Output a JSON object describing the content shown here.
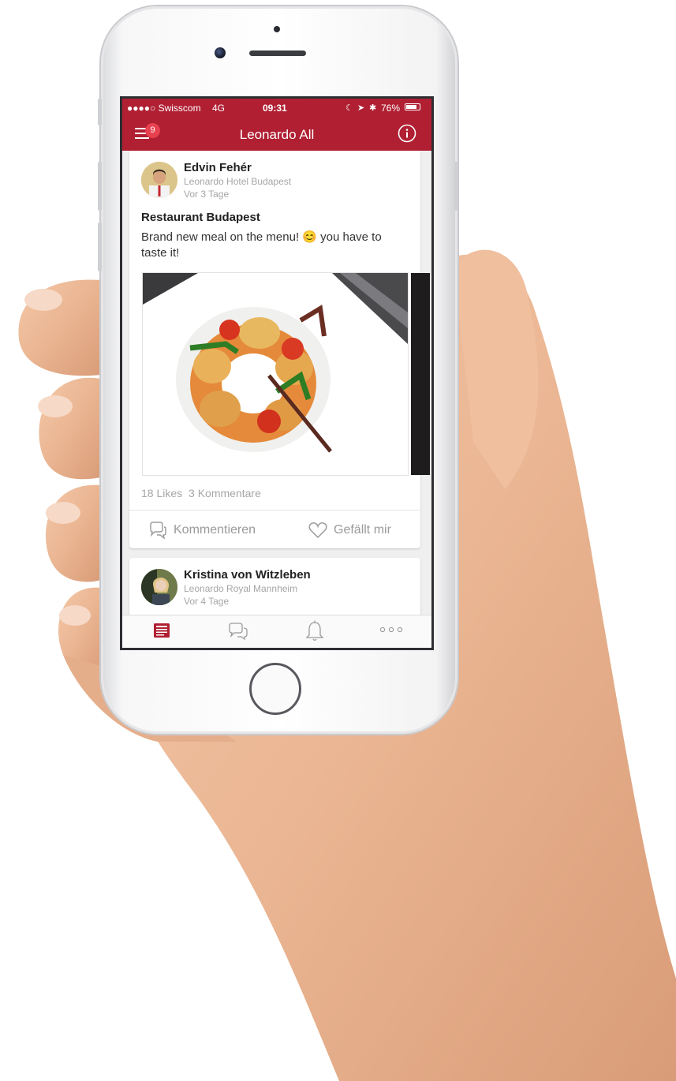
{
  "status_bar": {
    "carrier": "●●●●○ Swisscom",
    "network": "4G",
    "time": "09:31",
    "battery": "76%"
  },
  "nav": {
    "title": "Leonardo All",
    "menu_badge": "9"
  },
  "posts": [
    {
      "author": "Edvin Fehér",
      "hotel": "Leonardo Hotel Budapest",
      "time": "Vor 3 Tage",
      "title": "Restaurant Budapest",
      "text": "Brand new meal on the menu! 😊 you have to taste it!",
      "likes": "18 Likes",
      "comments": "3 Kommentare",
      "comment_label": "Kommentieren",
      "like_label": "Gefällt mir"
    },
    {
      "author": "Kristina von Witzleben",
      "hotel": "Leonardo Royal Mannheim",
      "time": "Vor 4 Tage"
    }
  ],
  "tabs": [
    "newspaper-icon",
    "chat-icon",
    "bell-icon",
    "more-icon"
  ],
  "colors": {
    "brand": "#b01f32",
    "badge": "#e8414f"
  }
}
